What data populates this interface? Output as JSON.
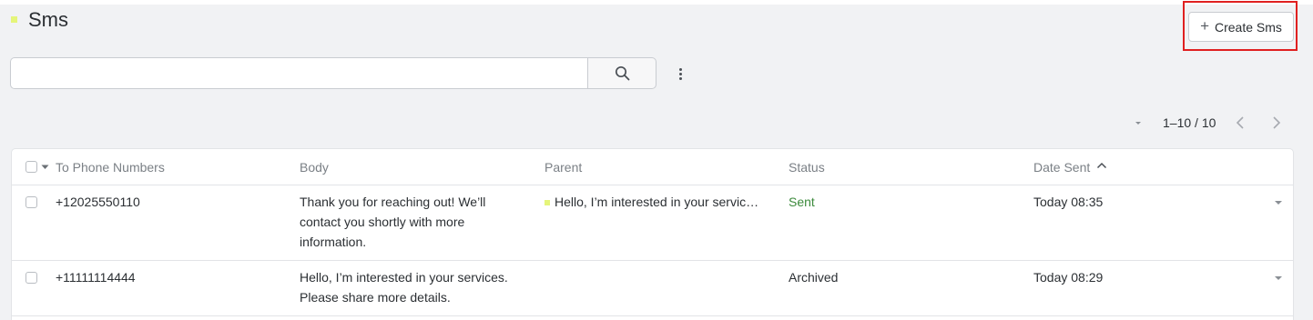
{
  "header": {
    "title": "Sms",
    "create_button": {
      "icon": "plus-icon",
      "label": "Create Sms"
    }
  },
  "search": {
    "value": "",
    "placeholder": "",
    "icon": "search-icon"
  },
  "more_menu_icon": "vertical-dots-icon",
  "pagination": {
    "range_text": "1–10 / 10"
  },
  "table": {
    "columns": [
      "To Phone Numbers",
      "Body",
      "Parent",
      "Status",
      "Date Sent"
    ],
    "sort": {
      "column": "Date Sent",
      "direction": "ascending"
    },
    "rows": [
      {
        "to": "+12025550110",
        "body_lines": [
          "Thank you for reaching out! We’ll",
          "contact you shortly with more",
          "information."
        ],
        "parent": "Hello, I’m interested in your servic…",
        "status": "Sent",
        "date_sent": "Today 08:35"
      },
      {
        "to": "+11111114444",
        "body_lines": [
          "Hello, I’m interested in your services.",
          "Please share more details."
        ],
        "parent": "",
        "status": "Archived",
        "date_sent": "Today 08:29"
      }
    ]
  },
  "colors": {
    "accent": "#e5f57a",
    "status_sent": "#3c8a3c",
    "highlight": "#e02020"
  }
}
